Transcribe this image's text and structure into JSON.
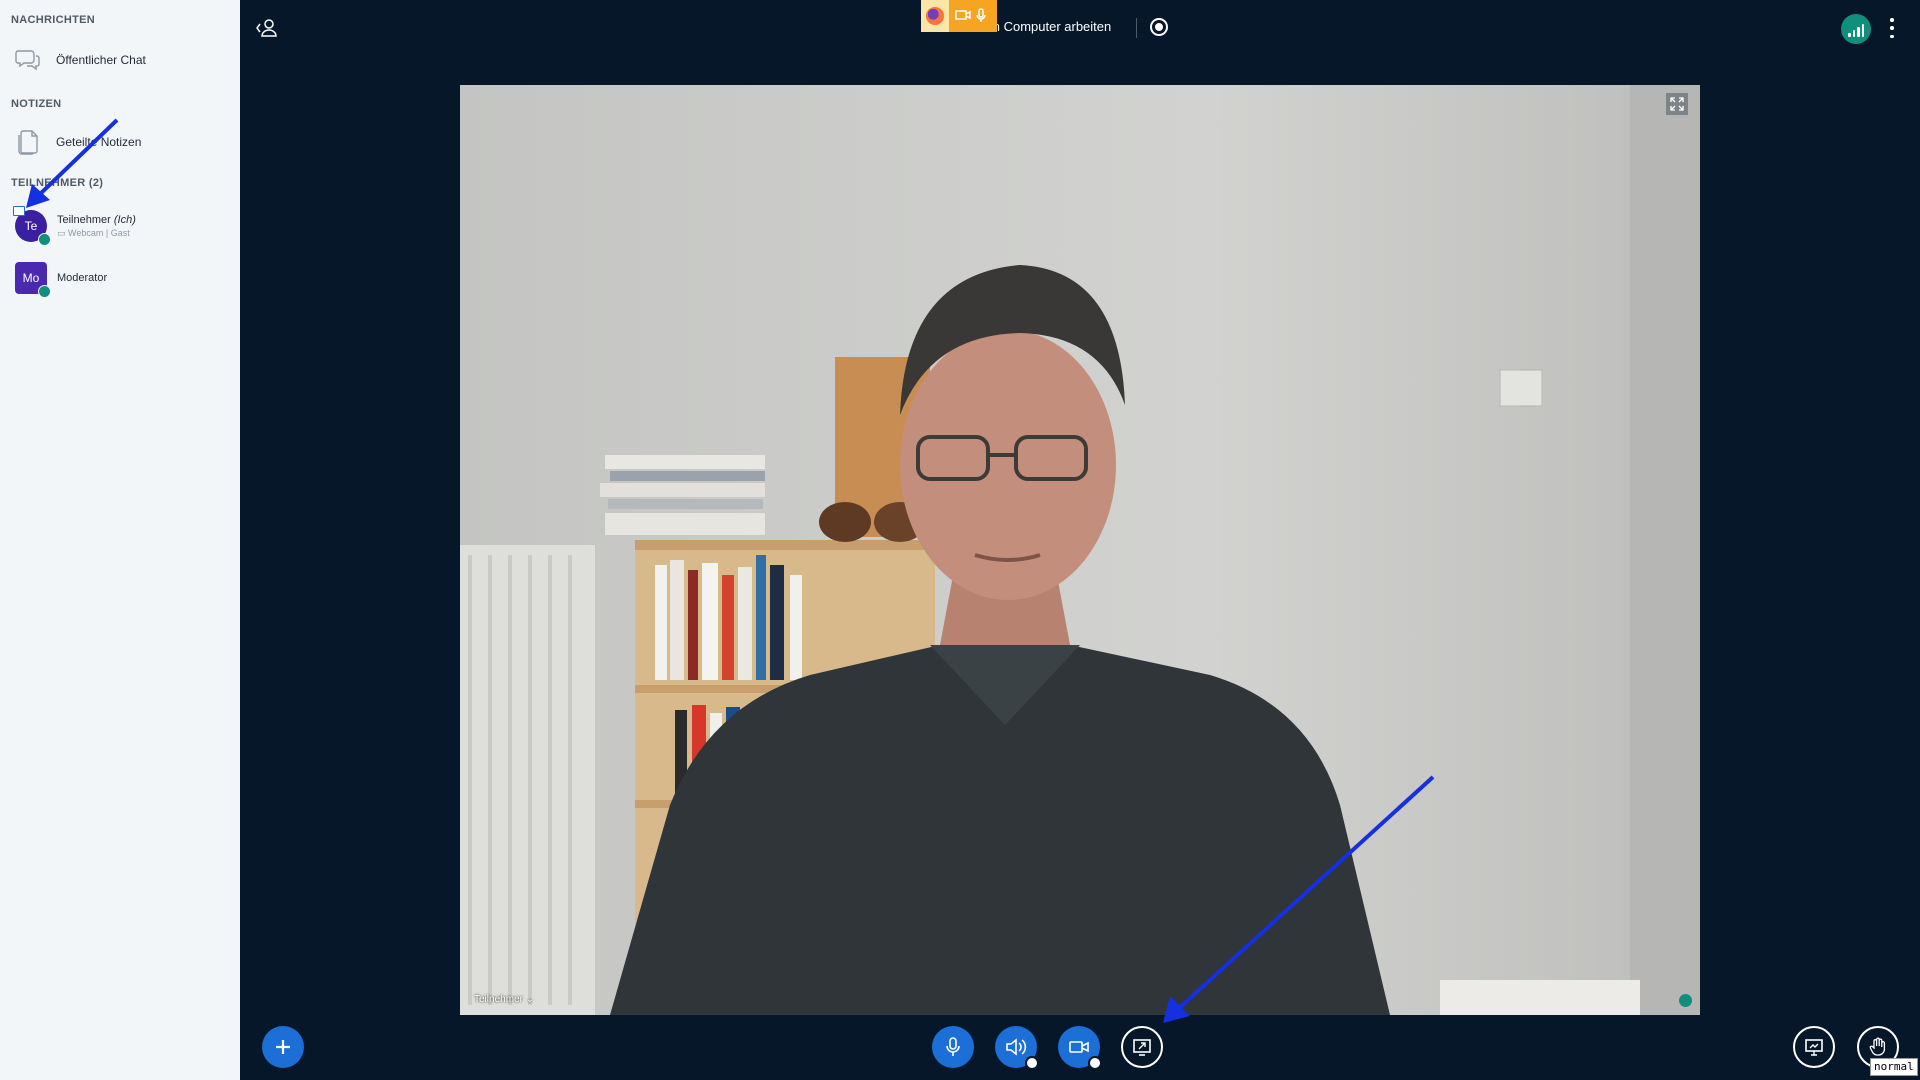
{
  "sidebar": {
    "messages_section": "NACHRICHTEN",
    "public_chat": "Öffentlicher Chat",
    "notes_section": "NOTIZEN",
    "shared_notes": "Geteilte Notizen",
    "users_section": "TEILNEHMER (2)",
    "users": [
      {
        "initials": "Te",
        "name": "Teilnehmer",
        "me_tag": "(Ich)",
        "sub": "Webcam | Gast",
        "color": "#3a1fa0"
      },
      {
        "initials": "Mo",
        "name": "Moderator",
        "color": "#4b28b0"
      }
    ]
  },
  "topbar": {
    "meeting_title": "Erlebt: Am Computer arbeiten"
  },
  "video": {
    "participant_name": "Teilnehmer ⌄"
  },
  "tooltip": "normal",
  "colors": {
    "background": "#06172a",
    "sidebar": "#f3f6f9",
    "accent_blue": "#1b6fd6",
    "connection_green": "#0f8f7c",
    "annotation_arrow": "#1530e0"
  }
}
